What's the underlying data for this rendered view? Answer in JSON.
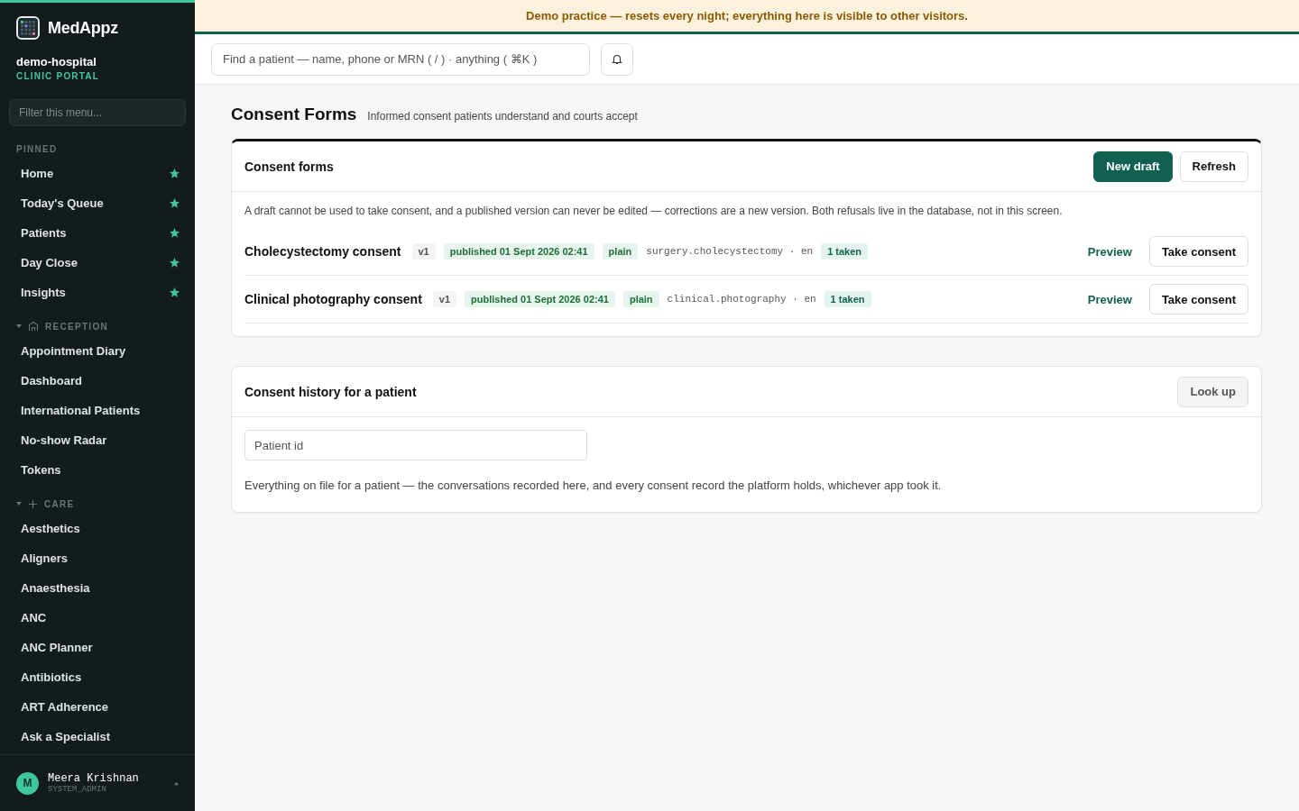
{
  "brand": {
    "name": "MedAppz",
    "org": "demo-hospital",
    "portal": "CLINIC PORTAL"
  },
  "sidebar": {
    "filter_placeholder": "Filter this menu...",
    "sections": [
      {
        "title": "PINNED",
        "items": [
          {
            "label": "Home",
            "pinned": true
          },
          {
            "label": "Today's Queue",
            "pinned": true
          },
          {
            "label": "Patients",
            "pinned": true
          },
          {
            "label": "Day Close",
            "pinned": true
          },
          {
            "label": "Insights",
            "pinned": true
          }
        ]
      },
      {
        "title": "RECEPTION",
        "expanded": true,
        "items": [
          {
            "label": "Appointment Diary",
            "pinned": false
          },
          {
            "label": "Dashboard",
            "pinned": false
          },
          {
            "label": "International Patients",
            "pinned": false
          },
          {
            "label": "No-show Radar",
            "pinned": false
          },
          {
            "label": "Tokens",
            "pinned": false
          }
        ]
      },
      {
        "title": "CARE",
        "expanded": true,
        "items": [
          {
            "label": "Aesthetics",
            "pinned": false
          },
          {
            "label": "Aligners",
            "pinned": false
          },
          {
            "label": "Anaesthesia",
            "pinned": false
          },
          {
            "label": "ANC",
            "pinned": false
          },
          {
            "label": "ANC Planner",
            "pinned": false
          },
          {
            "label": "Antibiotics",
            "pinned": false
          },
          {
            "label": "ART Adherence",
            "pinned": false
          },
          {
            "label": "Ask a Specialist",
            "pinned": false
          }
        ]
      }
    ],
    "user": {
      "initial": "M",
      "name": "Meera Krishnan",
      "role": "SYSTEM_ADMIN"
    }
  },
  "banner": "Demo practice — resets every night; everything here is visible to other visitors.",
  "search": {
    "placeholder": "Find a patient — name, phone or MRN ( / ) · anything ( ⌘K )"
  },
  "page": {
    "title": "Consent Forms",
    "subtitle": "Informed consent patients understand and courts accept"
  },
  "forms_card": {
    "title": "Consent forms",
    "buttons": [
      {
        "label": "New draft",
        "kind": "primary"
      },
      {
        "label": "Refresh",
        "kind": "secondary"
      }
    ],
    "note": "A draft cannot be used to take consent, and a published version can never be edited — corrections are a new version. Both refusals live in the database, not in this screen.",
    "forms": [
      {
        "name": "Cholecystectomy consent",
        "version": "v1",
        "status": "published 01 Sept 2026 02:41",
        "style": "plain",
        "code": "surgery.cholecystectomy · en",
        "taken": "1 taken",
        "preview": "Preview",
        "action": "Take consent"
      },
      {
        "name": "Clinical photography consent",
        "version": "v1",
        "status": "published 01 Sept 2026 02:41",
        "style": "plain",
        "code": "clinical.photography · en",
        "taken": "1 taken",
        "preview": "Preview",
        "action": "Take consent"
      }
    ]
  },
  "history_card": {
    "title": "Consent history for a patient",
    "button": {
      "label": "Look up",
      "disabled": true
    },
    "placeholder": "Patient id",
    "note": "Everything on file for a patient — the conversations recorded here, and every consent record the platform holds, whichever app took it."
  }
}
